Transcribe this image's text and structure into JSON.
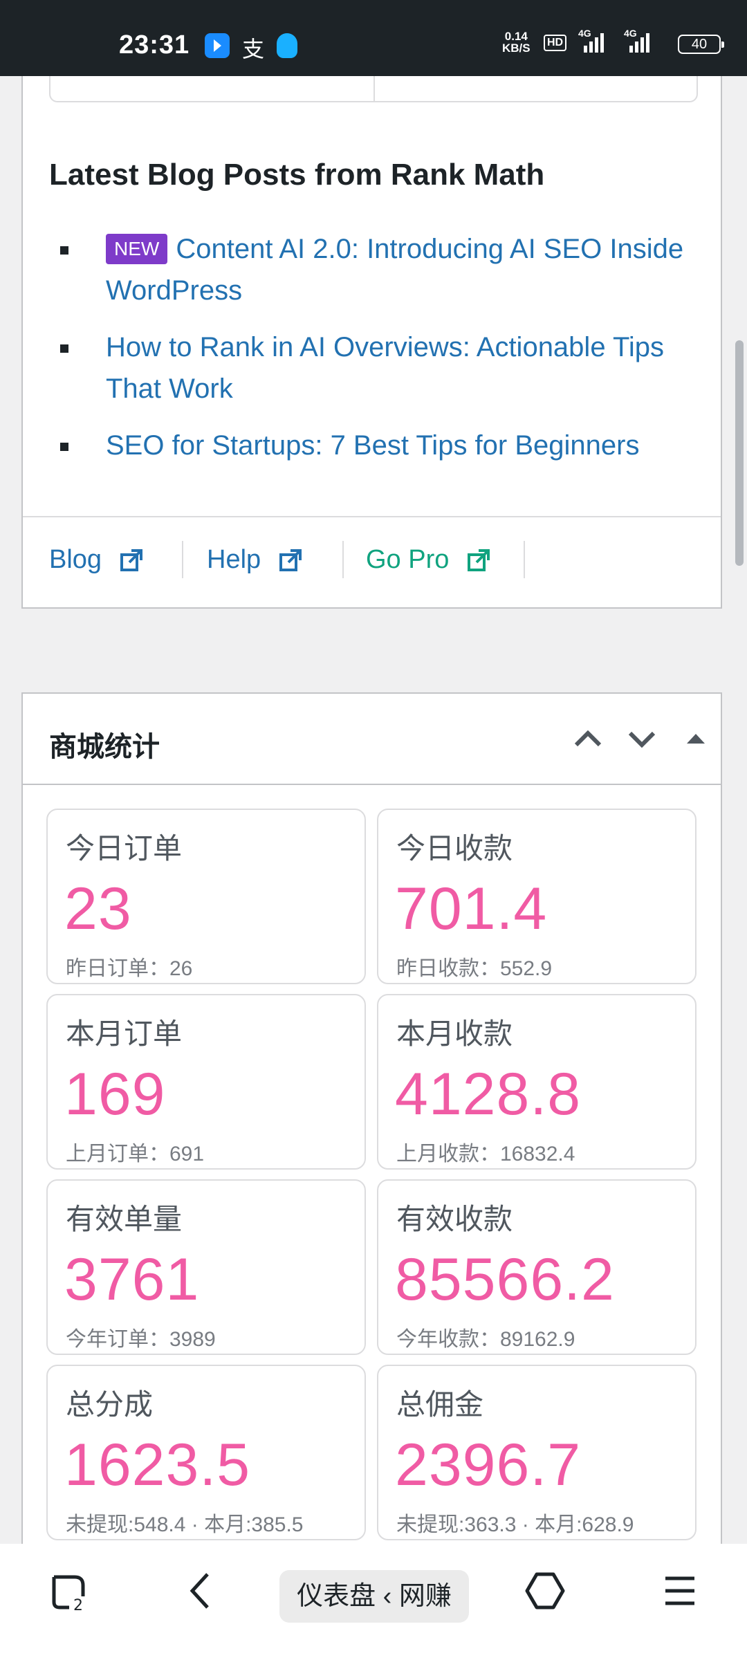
{
  "status_bar": {
    "time": "23:31",
    "app_icons": [
      "blue-arrow-icon",
      "alipay-icon",
      "qq-icon"
    ],
    "network_speed_value": "0.14",
    "network_speed_unit": "KB/S",
    "hd_label": "HD",
    "signal_labels": [
      "4G",
      "4G"
    ],
    "battery": "40"
  },
  "blog": {
    "heading": "Latest Blog Posts from Rank Math",
    "posts": [
      {
        "badge": "NEW",
        "title": "Content AI 2.0: Introducing AI SEO Inside WordPress"
      },
      {
        "title": "How to Rank in AI Overviews: Actionable Tips That Work"
      },
      {
        "title": "SEO for Startups: 7 Best Tips for Beginners"
      }
    ],
    "footer_links": [
      {
        "label": "Blog",
        "color": "#2271b1"
      },
      {
        "label": "Help",
        "color": "#2271b1"
      },
      {
        "label": "Go Pro",
        "color": "#10a37f"
      }
    ]
  },
  "shop_stats": {
    "title": "商城统计",
    "value_color": "#f05ba4",
    "boxes": [
      {
        "label": "今日订单",
        "value": "23",
        "sub": "昨日订单：26"
      },
      {
        "label": "今日收款",
        "value": "701.4",
        "sub": "昨日收款：552.9"
      },
      {
        "label": "本月订单",
        "value": "169",
        "sub": "上月订单：691"
      },
      {
        "label": "本月收款",
        "value": "4128.8",
        "sub": "上月收款：16832.4"
      },
      {
        "label": "有效单量",
        "value": "3761",
        "sub": "今年订单：3989"
      },
      {
        "label": "有效收款",
        "value": "85566.2",
        "sub": "今年收款：89162.9"
      },
      {
        "label": "总分成",
        "value": "1623.5",
        "sub": "未提现:548.4 · 本月:385.5"
      },
      {
        "label": "总佣金",
        "value": "2396.7",
        "sub": "未提现:363.3 · 本月:628.9"
      }
    ]
  },
  "bottom_nav": {
    "tabs_count": "2",
    "center_label": "仪表盘 ‹ 网赚"
  }
}
